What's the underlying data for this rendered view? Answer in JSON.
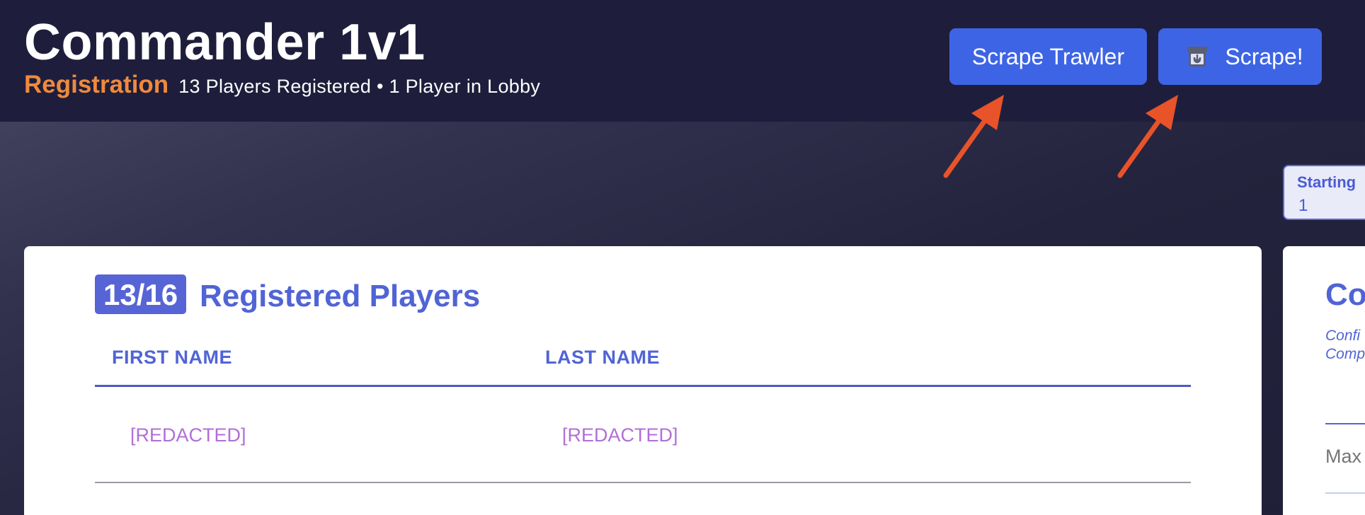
{
  "header": {
    "title": "Commander 1v1",
    "stage": "Registration",
    "stats": "13 Players Registered • 1 Player in Lobby"
  },
  "actions": {
    "scrape_trawler_label": "Scrape Trawler",
    "scrape_label": "Scrape!",
    "scrape_icon": "archive-download-icon"
  },
  "starting": {
    "label": "Starting",
    "value": "1"
  },
  "players_card": {
    "count": "13/16",
    "title": "Registered Players",
    "columns": [
      "FIRST NAME",
      "LAST NAME"
    ],
    "rows": [
      {
        "first": "[REDACTED]",
        "last": "[REDACTED]"
      }
    ]
  },
  "side_card": {
    "title": "Co",
    "desc_line1": "Confi",
    "desc_line2": "Comp",
    "input_placeholder": "Max"
  },
  "colors": {
    "header_bg": "#1e1e3c",
    "accent": "#3e64e6",
    "stage": "#ef8a3c",
    "heading": "#5064d6",
    "redacted": "#b06fd8",
    "annotation_arrow": "#e8532a"
  }
}
